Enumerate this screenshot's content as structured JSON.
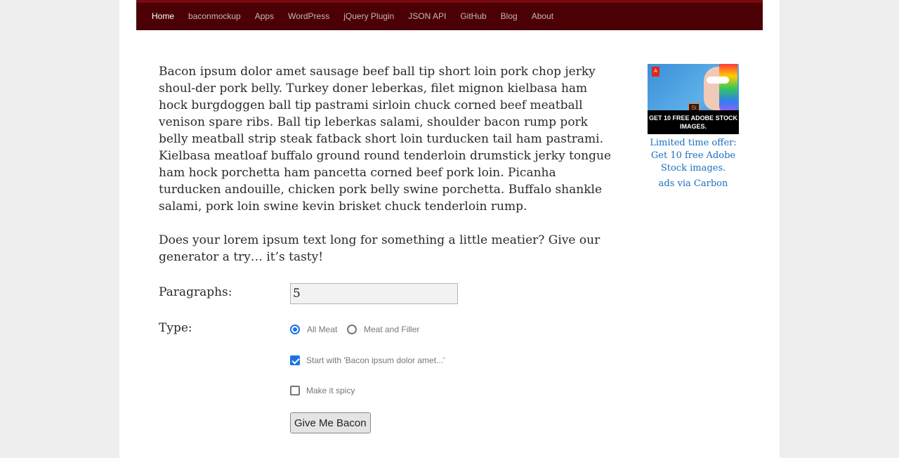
{
  "nav": {
    "items": [
      {
        "label": "Home",
        "active": true
      },
      {
        "label": "baconmockup"
      },
      {
        "label": "Apps"
      },
      {
        "label": "WordPress"
      },
      {
        "label": "jQuery Plugin"
      },
      {
        "label": "JSON API"
      },
      {
        "label": "GitHub"
      },
      {
        "label": "Blog"
      },
      {
        "label": "About"
      }
    ]
  },
  "content": {
    "paragraph1": "Bacon ipsum dolor amet sausage beef ball tip short loin pork chop jerky shoul-der pork belly. Turkey doner leberkas, filet mignon kielbasa ham hock burgdoggen ball tip pastrami sirloin chuck corned beef meatball venison spare ribs. Ball tip leberkas salami, shoulder bacon rump pork belly meatball strip steak fatback short loin turducken tail ham pastrami. Kielbasa meatloaf buffalo ground round tenderloin drumstick jerky tongue ham hock porchetta ham pancetta corned beef pork loin. Picanha turducken andouille, chicken pork belly swine porchetta. Buffalo shankle salami, pork loin swine kevin brisket chuck tenderloin rump.",
    "paragraph2": "Does your lorem ipsum text long for something a little meatier? Give our generator a try… it’s tasty!"
  },
  "form": {
    "paragraphs_label": "Paragraphs:",
    "paragraphs_value": "5",
    "type_label": "Type:",
    "type_options": [
      {
        "label": "All Meat",
        "selected": true
      },
      {
        "label": "Meat and Filler",
        "selected": false
      }
    ],
    "start_with_label": "Start with 'Bacon ipsum dolor amet...'",
    "start_with_checked": true,
    "spicy_label": "Make it spicy",
    "spicy_checked": false,
    "submit_label": "Give Me Bacon"
  },
  "ad": {
    "image_adobe_logo": "A",
    "image_stock_badge": "St",
    "image_banner": "GET 10 FREE ADOBE STOCK IMAGES.",
    "text": "Limited time offer: Get 10 free Adobe Stock images.",
    "via": "ads via Carbon"
  },
  "colors": {
    "nav_bg": "#4a0005",
    "link": "#1a6fc1",
    "control_accent": "#1a73e8"
  }
}
